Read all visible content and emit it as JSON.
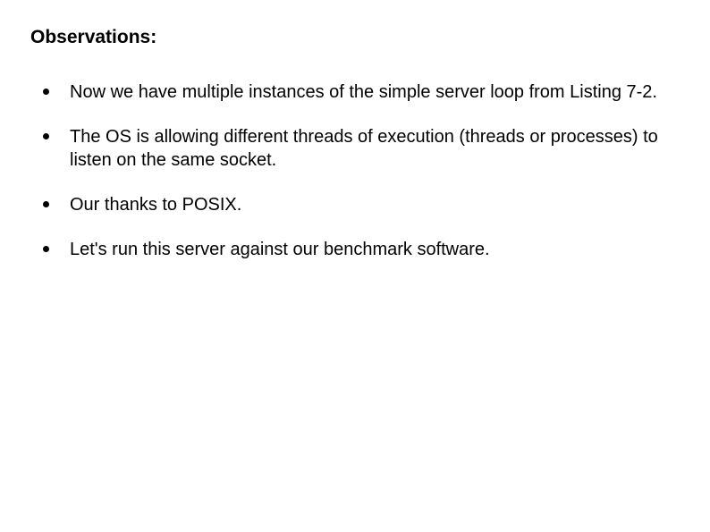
{
  "heading": "Observations:",
  "bullets": [
    "Now we have multiple instances of the simple server loop from Listing 7-2.",
    "The OS is allowing different threads of execution (threads or processes) to listen on the same socket.",
    "Our thanks to POSIX.",
    "Let's run this server against our benchmark software."
  ]
}
